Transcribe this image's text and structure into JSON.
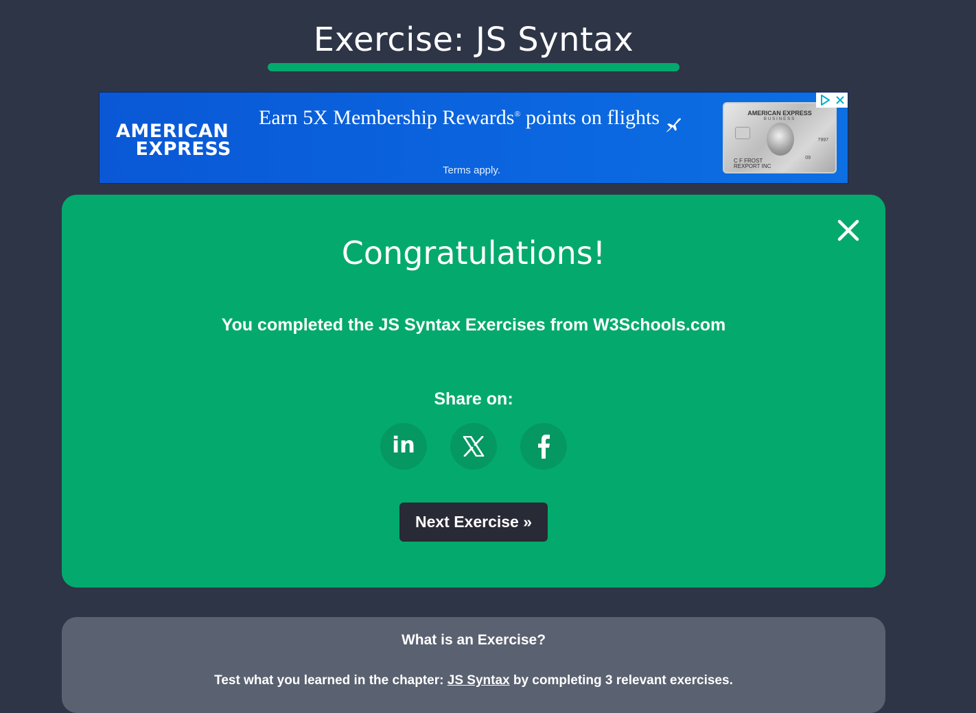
{
  "page": {
    "title": "Exercise: JS Syntax",
    "accent_color": "#04aa6d",
    "background_color": "#2e3547"
  },
  "ad": {
    "brand_line1": "AMERICAN",
    "brand_line2": "EXPRESS",
    "headline_main": "Earn 5X Membership Rewards",
    "headline_mark": "®",
    "headline_tail": " points on flights",
    "terms": "Terms apply.",
    "card": {
      "brand": "AMERICAN EXPRESS",
      "sub": "BUSINESS",
      "number": "7997",
      "holder_line1": "C F FROST",
      "holder_line2": "REXPORT INC",
      "exp": "09"
    },
    "choices_icon": "adchoices-icon",
    "close_icon": "close-icon"
  },
  "congrats": {
    "title": "Congratulations!",
    "message": "You completed the JS Syntax Exercises from W3Schools.com",
    "share_label": "Share on:",
    "share_buttons": [
      {
        "name": "linkedin",
        "icon": "linkedin-icon",
        "glyph": "in"
      },
      {
        "name": "x",
        "icon": "x-icon"
      },
      {
        "name": "facebook",
        "icon": "facebook-icon"
      }
    ],
    "next_label": "Next Exercise »",
    "close_icon": "close-icon"
  },
  "info": {
    "title": "What is an Exercise?",
    "text_before": "Test what you learned in the chapter: ",
    "link_text": "JS Syntax",
    "text_after": " by completing 3 relevant exercises."
  }
}
